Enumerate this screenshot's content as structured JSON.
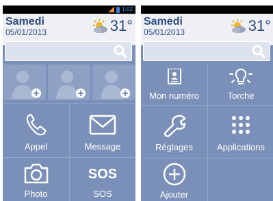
{
  "left_screen": {
    "status": {
      "time": "1:02"
    },
    "header": {
      "day": "Samedi",
      "date": "05/01/2013",
      "temperature": "31°"
    },
    "tiles": {
      "call": "Appel",
      "message": "Message",
      "photo": "Photo",
      "sos_icon_text": "SOS",
      "sos": "SOS"
    }
  },
  "right_screen": {
    "header": {
      "day": "Samedi",
      "date": "05/01/2013",
      "temperature": "31°"
    },
    "tiles": {
      "my_number": "Mon numéro",
      "torch": "Torche",
      "settings": "Réglages",
      "applications": "Applications",
      "add": "Ajouter"
    }
  },
  "colors": {
    "tile_bg": "#7a90b8",
    "header_text": "#2e4a7e",
    "header_bg": "#eef0f6"
  },
  "icons": [
    "signal-icon",
    "battery-icon",
    "weather-sun-cloud-icon",
    "search-icon",
    "add-contact-icon",
    "phone-icon",
    "mail-icon",
    "camera-icon",
    "id-card-icon",
    "bulb-icon",
    "wrench-icon",
    "grid-icon",
    "plus-circle-icon"
  ]
}
